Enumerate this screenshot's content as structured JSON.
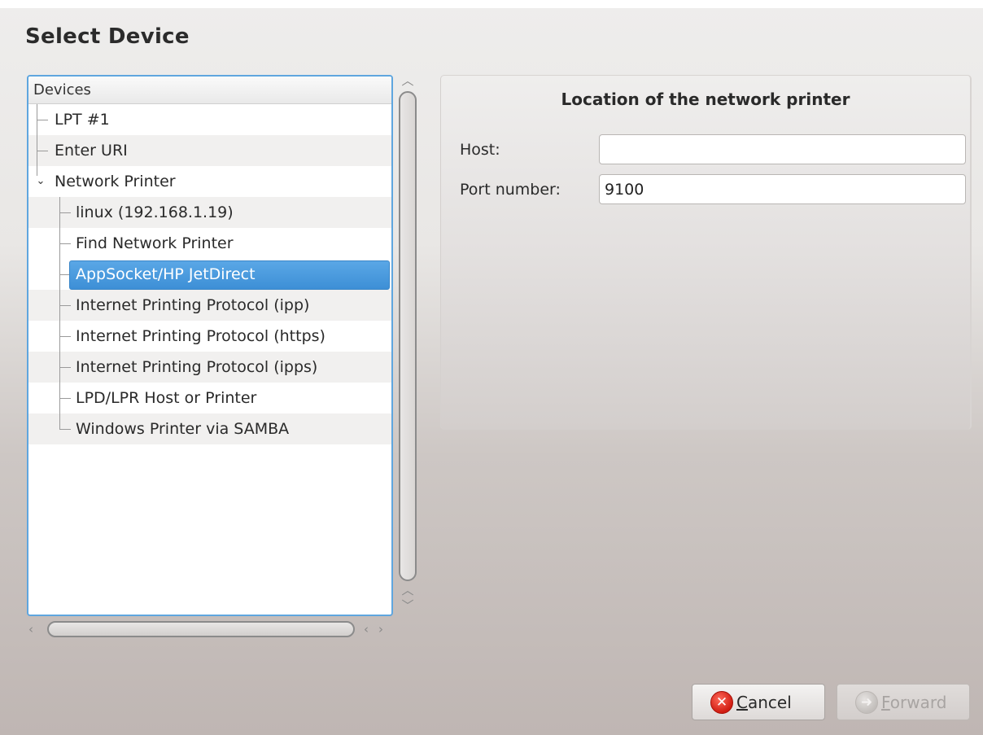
{
  "page": {
    "title": "Select Device"
  },
  "tree": {
    "header": "Devices",
    "items": [
      {
        "label": "LPT #1"
      },
      {
        "label": "Enter URI"
      },
      {
        "label": "Network Printer",
        "expanded": true
      },
      {
        "label": "linux (192.168.1.19)"
      },
      {
        "label": "Find Network Printer"
      },
      {
        "label": "AppSocket/HP JetDirect",
        "selected": true
      },
      {
        "label": "Internet Printing Protocol (ipp)"
      },
      {
        "label": "Internet Printing Protocol (https)"
      },
      {
        "label": "Internet Printing Protocol (ipps)"
      },
      {
        "label": "LPD/LPR Host or Printer"
      },
      {
        "label": "Windows Printer via SAMBA"
      }
    ]
  },
  "panel": {
    "title": "Location of the network printer",
    "host_label": "Host:",
    "host_value": "",
    "port_label": "Port number:",
    "port_value": "9100"
  },
  "buttons": {
    "cancel_mnemonic": "C",
    "cancel_rest": "ancel",
    "forward_mnemonic": "F",
    "forward_rest": "orward",
    "forward_enabled": false
  },
  "icons": {
    "cancel": "cancel-icon",
    "forward": "forward-icon",
    "expander": "chevron-down-icon"
  },
  "colors": {
    "selection": "#3d8fd6",
    "focus_border": "#5fa6df",
    "cancel_icon": "#d01d12"
  }
}
